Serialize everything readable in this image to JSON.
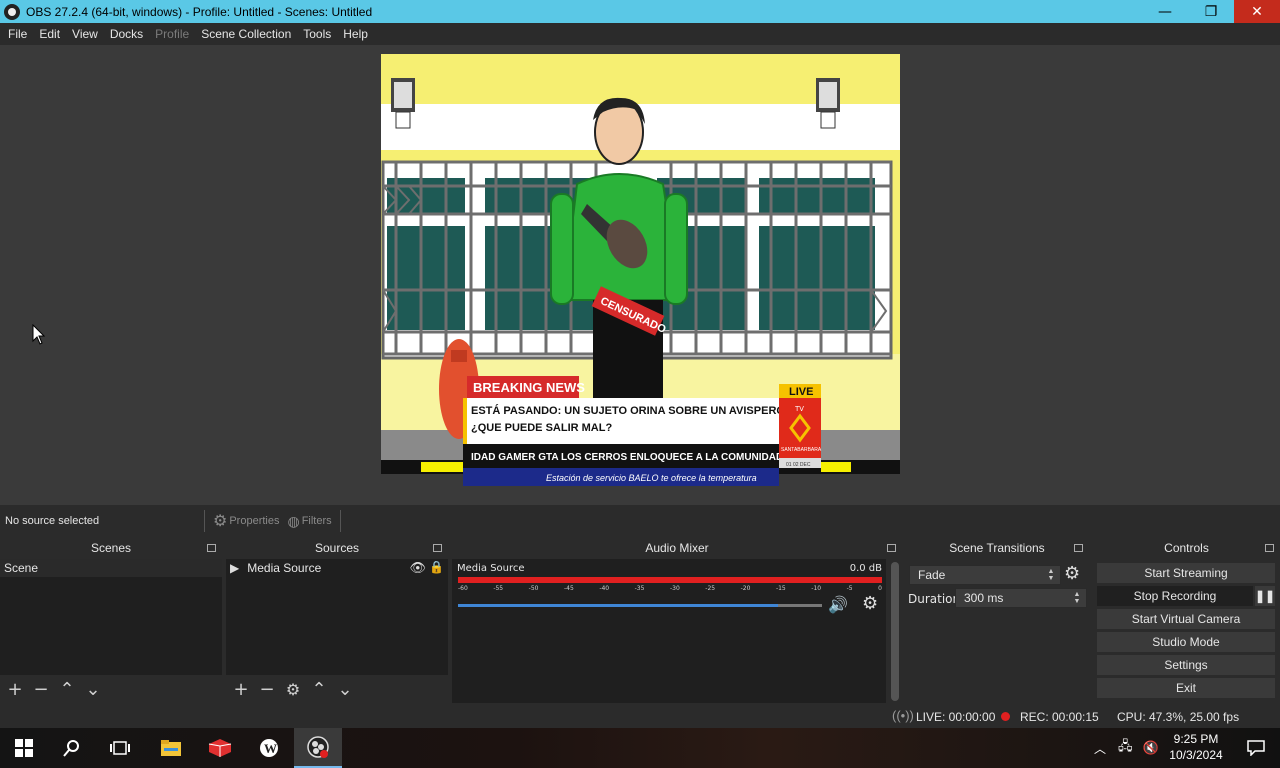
{
  "window": {
    "title": "OBS 27.2.4 (64-bit, windows) - Profile: Untitled - Scenes: Untitled",
    "minimize": "—",
    "maximize": "❐",
    "close": "✕"
  },
  "menu": [
    "File",
    "Edit",
    "View",
    "Docks",
    "Profile",
    "Scene Collection",
    "Tools",
    "Help"
  ],
  "preview": {
    "breaking_news": "BREAKING NEWS",
    "headline_line1": "ESTÁ PASANDO: UN SUJETO ORINA SOBRE UN AVISPERO",
    "headline_line2": "¿QUE PUEDE SALIR MAL?",
    "ticker": "IDAD GAMER   GTA LOS CERROS ENLOQUECE A LA COMUNIDAD (",
    "sponsor": "Estación de servicio BAELO te ofrece la temperatura",
    "live": "LIVE",
    "channel_tv": "TV",
    "channel_name": "SANTABARBARA",
    "channel_time": "01 02 DEC",
    "censored": "CENSURADO"
  },
  "source_toolbar": {
    "no_source": "No source selected",
    "properties": "Properties",
    "filters": "Filters"
  },
  "scenes": {
    "title": "Scenes",
    "items": [
      "Scene"
    ]
  },
  "sources": {
    "title": "Sources",
    "items": [
      "Media Source"
    ]
  },
  "mixer": {
    "title": "Audio Mixer",
    "channel_name": "Media Source",
    "db_value": "0.0 dB",
    "ticks": [
      "-60",
      "-55",
      "-50",
      "-45",
      "-40",
      "-35",
      "-30",
      "-25",
      "-20",
      "-15",
      "-10",
      "-5",
      "0"
    ],
    "volume_level": 0.88
  },
  "transitions": {
    "title": "Scene Transitions",
    "selected": "Fade",
    "duration_label": "Duration",
    "duration_value": "300 ms"
  },
  "controls": {
    "title": "Controls",
    "start_streaming": "Start Streaming",
    "stop_recording": "Stop Recording",
    "start_virtual_camera": "Start Virtual Camera",
    "studio_mode": "Studio Mode",
    "settings": "Settings",
    "exit": "Exit"
  },
  "status": {
    "live": "LIVE: 00:00:00",
    "rec": "REC: 00:00:15",
    "cpu": "CPU: 47.3%, 25.00 fps"
  },
  "taskbar": {
    "time": "9:25 PM",
    "date": "10/3/2024"
  },
  "colors": {
    "titlebar": "#5ac8e6",
    "meter_red": "#e02020",
    "volume_blue": "#3f86d6",
    "rec_dot": "#e02020"
  }
}
